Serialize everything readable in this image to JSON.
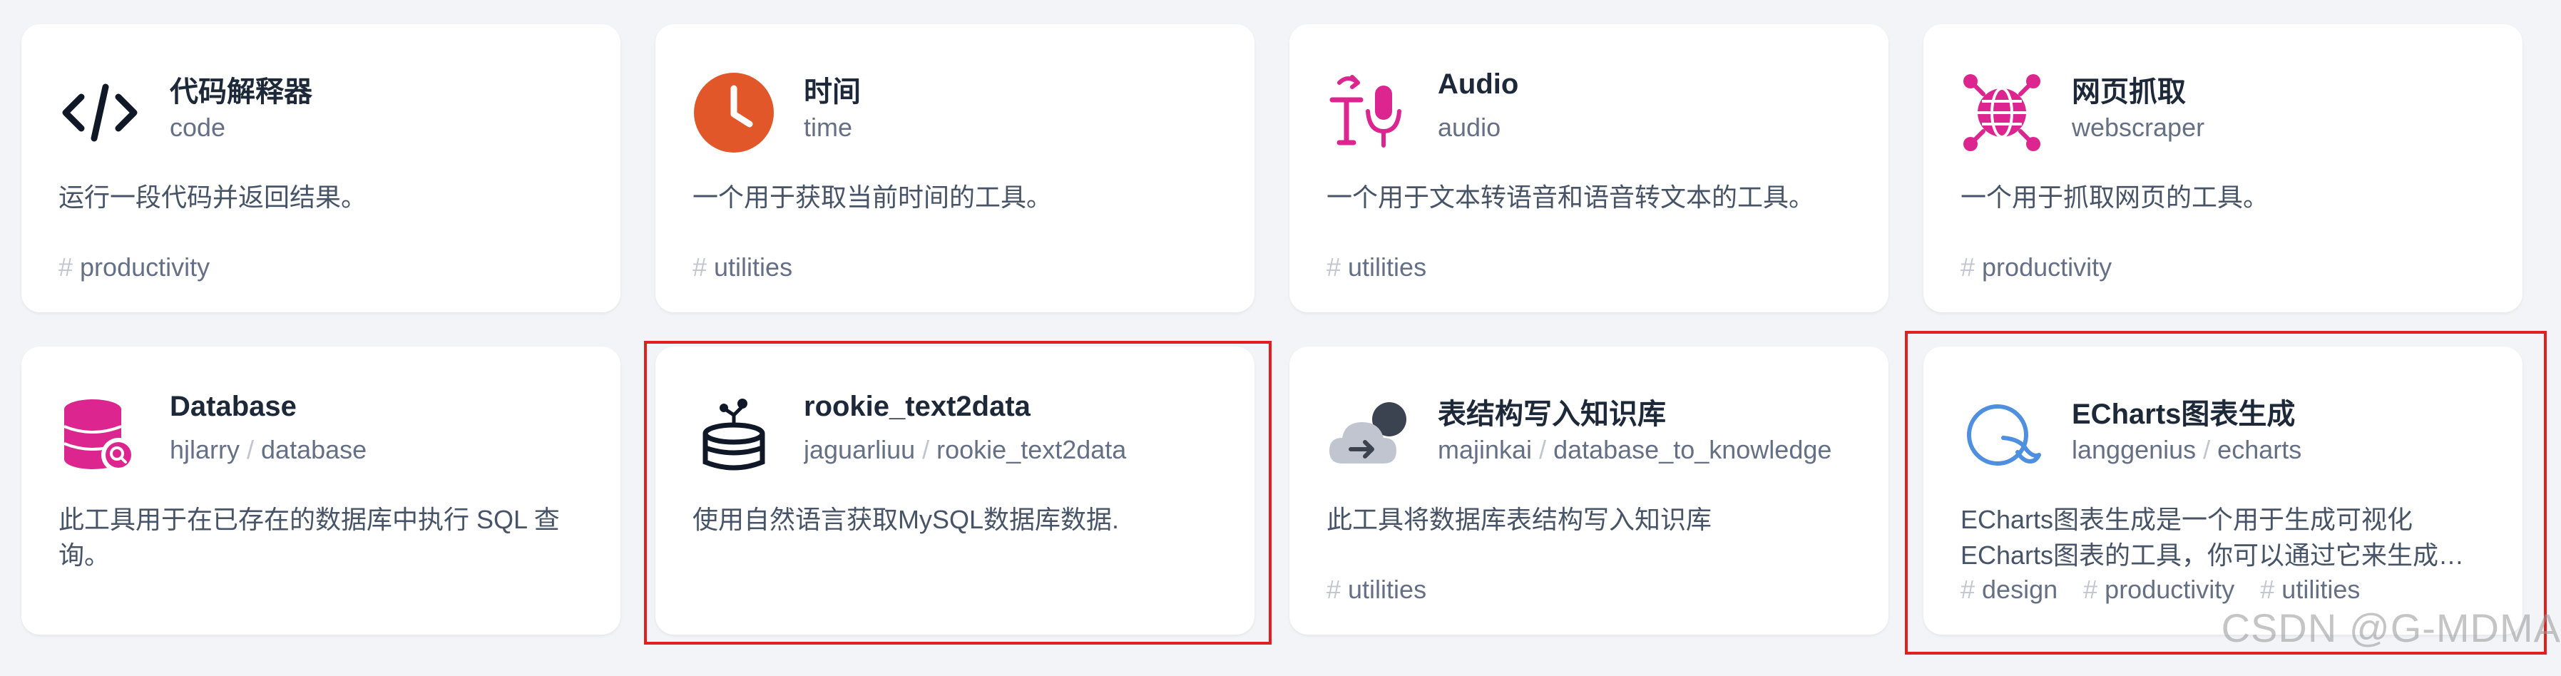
{
  "cards": [
    {
      "title": "代码解释器",
      "subtitle_author": "",
      "subtitle_name": "code",
      "description": "运行一段代码并返回结果。",
      "tags": [
        "productivity"
      ],
      "icon": "code-icon"
    },
    {
      "title": "时间",
      "subtitle_author": "",
      "subtitle_name": "time",
      "description": "一个用于获取当前时间的工具。",
      "tags": [
        "utilities"
      ],
      "icon": "clock-icon"
    },
    {
      "title": "Audio",
      "subtitle_author": "",
      "subtitle_name": "audio",
      "description": "一个用于文本转语音和语音转文本的工具。",
      "tags": [
        "utilities"
      ],
      "icon": "text-to-speech-icon"
    },
    {
      "title": "网页抓取",
      "subtitle_author": "",
      "subtitle_name": "webscraper",
      "description": "一个用于抓取网页的工具。",
      "tags": [
        "productivity"
      ],
      "icon": "web-globe-icon"
    },
    {
      "title": "Database",
      "subtitle_author": "hjlarry",
      "subtitle_name": "database",
      "description": "此工具用于在已存在的数据库中执行 SQL 查询。",
      "tags": [],
      "icon": "database-search-icon"
    },
    {
      "title": "rookie_text2data",
      "subtitle_author": "jaguarliuu",
      "subtitle_name": "rookie_text2data",
      "description": "使用自然语言获取MySQL数据库数据.",
      "tags": [],
      "icon": "database-network-icon"
    },
    {
      "title": "表结构写入知识库",
      "subtitle_author": "majinkai",
      "subtitle_name": "database_to_knowledge",
      "description": "此工具将数据库表结构写入知识库",
      "tags": [
        "utilities"
      ],
      "icon": "cloud-upload-icon"
    },
    {
      "title": "ECharts图表生成",
      "subtitle_author": "langgenius",
      "subtitle_name": "echarts",
      "description": "ECharts图表生成是一个用于生成可视化ECharts图表的工具，你可以通过它来生成柱状图、折线图、饼图等各类图表。",
      "tags": [
        "design",
        "productivity",
        "utilities"
      ],
      "icon": "echarts-icon"
    }
  ],
  "watermark": "CSDN @G-MDMA",
  "colors": {
    "highlight": "#e02020",
    "accent_orange": "#e2572a",
    "accent_pink": "#dd2590",
    "accent_blue": "#4f8fe0"
  }
}
